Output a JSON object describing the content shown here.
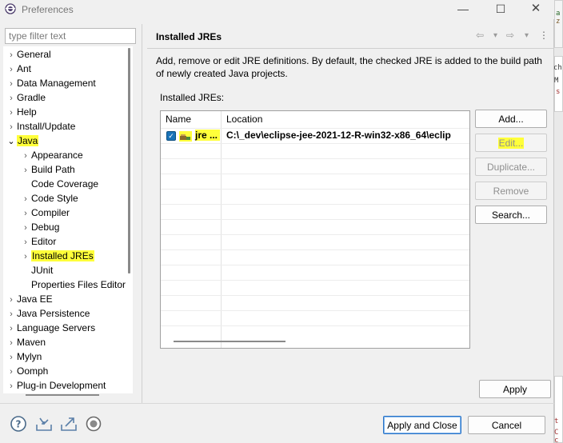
{
  "window": {
    "title": "Preferences"
  },
  "titlebar": {
    "minimize_label": "—",
    "maximize_label": "☐",
    "close_label": "✕"
  },
  "filter": {
    "placeholder": "type filter text"
  },
  "tree": {
    "items": [
      {
        "label": "General",
        "arrow": "›"
      },
      {
        "label": "Ant",
        "arrow": "›"
      },
      {
        "label": "Data Management",
        "arrow": "›"
      },
      {
        "label": "Gradle",
        "arrow": "›"
      },
      {
        "label": "Help",
        "arrow": "›"
      },
      {
        "label": "Install/Update",
        "arrow": "›"
      },
      {
        "label": "Java",
        "arrow": "⌄"
      },
      {
        "label": "Appearance",
        "arrow": "›"
      },
      {
        "label": "Build Path",
        "arrow": "›"
      },
      {
        "label": "Code Coverage",
        "arrow": ""
      },
      {
        "label": "Code Style",
        "arrow": "›"
      },
      {
        "label": "Compiler",
        "arrow": "›"
      },
      {
        "label": "Debug",
        "arrow": "›"
      },
      {
        "label": "Editor",
        "arrow": "›"
      },
      {
        "label": "Installed JREs",
        "arrow": "›"
      },
      {
        "label": "JUnit",
        "arrow": ""
      },
      {
        "label": "Properties Files Editor",
        "arrow": ""
      },
      {
        "label": "Java EE",
        "arrow": "›"
      },
      {
        "label": "Java Persistence",
        "arrow": "›"
      },
      {
        "label": "Language Servers",
        "arrow": "›"
      },
      {
        "label": "Maven",
        "arrow": "›"
      },
      {
        "label": "Mylyn",
        "arrow": "›"
      },
      {
        "label": "Oomph",
        "arrow": "›"
      },
      {
        "label": "Plug-in Development",
        "arrow": "›"
      }
    ]
  },
  "page": {
    "title": "Installed JREs",
    "nav": {
      "back": "⇦",
      "back_menu": "▾",
      "forward": "⇨",
      "forward_menu": "▾",
      "more": "⋮"
    },
    "description": "Add, remove or edit JRE definitions. By default, the checked JRE is added to the build path of newly created Java projects.",
    "installed_label": "Installed JREs:",
    "table": {
      "columns": [
        "Name",
        "Location"
      ],
      "rows": [
        {
          "name": "jre ...",
          "location": "C:\\_dev\\eclipse-jee-2021-12-R-win32-x86_64\\eclip",
          "checked": true,
          "check_mark": "✓"
        }
      ]
    },
    "buttons": {
      "add": "Add...",
      "edit": "Edit...",
      "duplicate": "Duplicate...",
      "remove": "Remove",
      "search": "Search...",
      "apply": "Apply"
    }
  },
  "footer": {
    "apply_close": "Apply and Close",
    "cancel": "Cancel"
  },
  "background": {
    "fragments": [
      "a",
      "z",
      "ch",
      "M",
      "s",
      "t",
      "C",
      "c"
    ]
  },
  "colors": {
    "highlight": "#ffff3a",
    "accent": "#2a74c8",
    "check": "#1a73b8"
  }
}
